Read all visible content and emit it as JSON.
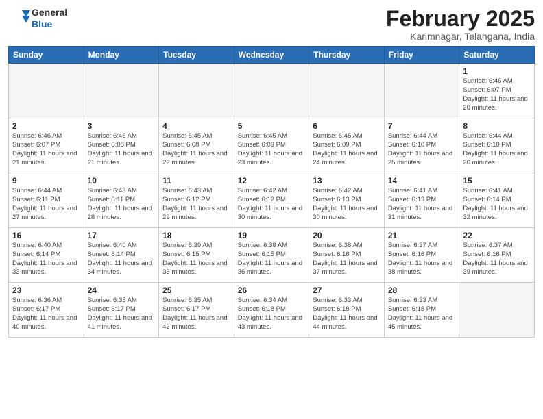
{
  "header": {
    "logo_general": "General",
    "logo_blue": "Blue",
    "title": "February 2025",
    "subtitle": "Karimnagar, Telangana, India"
  },
  "weekdays": [
    "Sunday",
    "Monday",
    "Tuesday",
    "Wednesday",
    "Thursday",
    "Friday",
    "Saturday"
  ],
  "weeks": [
    [
      {
        "day": "",
        "empty": true
      },
      {
        "day": "",
        "empty": true
      },
      {
        "day": "",
        "empty": true
      },
      {
        "day": "",
        "empty": true
      },
      {
        "day": "",
        "empty": true
      },
      {
        "day": "",
        "empty": true
      },
      {
        "day": "1",
        "sunrise": "6:46 AM",
        "sunset": "6:07 PM",
        "daylight": "11 hours and 20 minutes."
      }
    ],
    [
      {
        "day": "2",
        "sunrise": "6:46 AM",
        "sunset": "6:07 PM",
        "daylight": "11 hours and 21 minutes."
      },
      {
        "day": "3",
        "sunrise": "6:46 AM",
        "sunset": "6:08 PM",
        "daylight": "11 hours and 21 minutes."
      },
      {
        "day": "4",
        "sunrise": "6:45 AM",
        "sunset": "6:08 PM",
        "daylight": "11 hours and 22 minutes."
      },
      {
        "day": "5",
        "sunrise": "6:45 AM",
        "sunset": "6:09 PM",
        "daylight": "11 hours and 23 minutes."
      },
      {
        "day": "6",
        "sunrise": "6:45 AM",
        "sunset": "6:09 PM",
        "daylight": "11 hours and 24 minutes."
      },
      {
        "day": "7",
        "sunrise": "6:44 AM",
        "sunset": "6:10 PM",
        "daylight": "11 hours and 25 minutes."
      },
      {
        "day": "8",
        "sunrise": "6:44 AM",
        "sunset": "6:10 PM",
        "daylight": "11 hours and 26 minutes."
      }
    ],
    [
      {
        "day": "9",
        "sunrise": "6:44 AM",
        "sunset": "6:11 PM",
        "daylight": "11 hours and 27 minutes."
      },
      {
        "day": "10",
        "sunrise": "6:43 AM",
        "sunset": "6:11 PM",
        "daylight": "11 hours and 28 minutes."
      },
      {
        "day": "11",
        "sunrise": "6:43 AM",
        "sunset": "6:12 PM",
        "daylight": "11 hours and 29 minutes."
      },
      {
        "day": "12",
        "sunrise": "6:42 AM",
        "sunset": "6:12 PM",
        "daylight": "11 hours and 30 minutes."
      },
      {
        "day": "13",
        "sunrise": "6:42 AM",
        "sunset": "6:13 PM",
        "daylight": "11 hours and 30 minutes."
      },
      {
        "day": "14",
        "sunrise": "6:41 AM",
        "sunset": "6:13 PM",
        "daylight": "11 hours and 31 minutes."
      },
      {
        "day": "15",
        "sunrise": "6:41 AM",
        "sunset": "6:14 PM",
        "daylight": "11 hours and 32 minutes."
      }
    ],
    [
      {
        "day": "16",
        "sunrise": "6:40 AM",
        "sunset": "6:14 PM",
        "daylight": "11 hours and 33 minutes."
      },
      {
        "day": "17",
        "sunrise": "6:40 AM",
        "sunset": "6:14 PM",
        "daylight": "11 hours and 34 minutes."
      },
      {
        "day": "18",
        "sunrise": "6:39 AM",
        "sunset": "6:15 PM",
        "daylight": "11 hours and 35 minutes."
      },
      {
        "day": "19",
        "sunrise": "6:38 AM",
        "sunset": "6:15 PM",
        "daylight": "11 hours and 36 minutes."
      },
      {
        "day": "20",
        "sunrise": "6:38 AM",
        "sunset": "6:16 PM",
        "daylight": "11 hours and 37 minutes."
      },
      {
        "day": "21",
        "sunrise": "6:37 AM",
        "sunset": "6:16 PM",
        "daylight": "11 hours and 38 minutes."
      },
      {
        "day": "22",
        "sunrise": "6:37 AM",
        "sunset": "6:16 PM",
        "daylight": "11 hours and 39 minutes."
      }
    ],
    [
      {
        "day": "23",
        "sunrise": "6:36 AM",
        "sunset": "6:17 PM",
        "daylight": "11 hours and 40 minutes."
      },
      {
        "day": "24",
        "sunrise": "6:35 AM",
        "sunset": "6:17 PM",
        "daylight": "11 hours and 41 minutes."
      },
      {
        "day": "25",
        "sunrise": "6:35 AM",
        "sunset": "6:17 PM",
        "daylight": "11 hours and 42 minutes."
      },
      {
        "day": "26",
        "sunrise": "6:34 AM",
        "sunset": "6:18 PM",
        "daylight": "11 hours and 43 minutes."
      },
      {
        "day": "27",
        "sunrise": "6:33 AM",
        "sunset": "6:18 PM",
        "daylight": "11 hours and 44 minutes."
      },
      {
        "day": "28",
        "sunrise": "6:33 AM",
        "sunset": "6:18 PM",
        "daylight": "11 hours and 45 minutes."
      },
      {
        "day": "",
        "empty": true
      }
    ]
  ],
  "labels": {
    "sunrise": "Sunrise:",
    "sunset": "Sunset:",
    "daylight": "Daylight:"
  }
}
